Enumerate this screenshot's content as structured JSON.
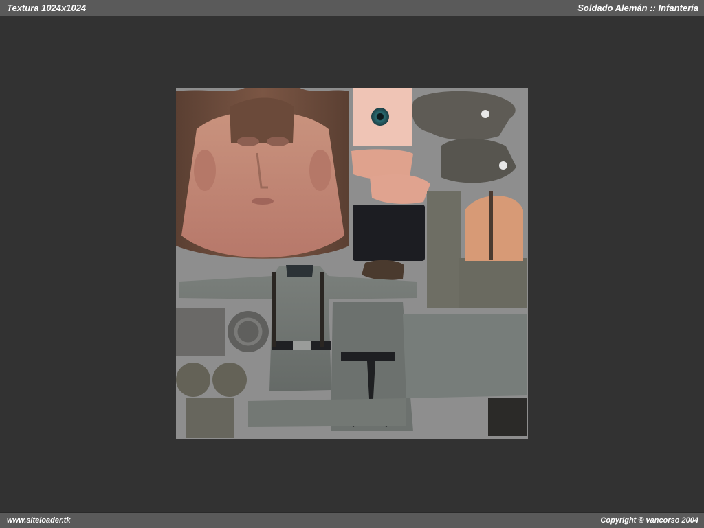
{
  "header": {
    "left_title": "Textura 1024x1024",
    "right_title": "Soldado Alemán :: Infantería"
  },
  "footer": {
    "left_text": "www.siteloader.tk",
    "right_text": "Copyright © vancorso 2004"
  },
  "colors": {
    "page_background": "#323232",
    "bar_background": "#5a5a5a",
    "bar_text": "#ffffff",
    "texture_background": "#8e8e8e",
    "uniform_grey": "#6f7470",
    "skin": "#c88a76"
  }
}
